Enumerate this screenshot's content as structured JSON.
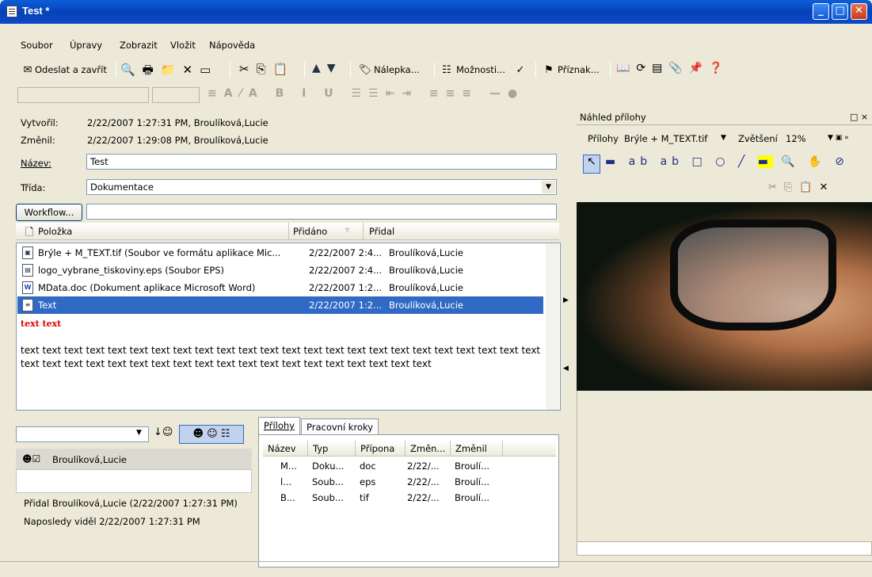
{
  "window": {
    "title": "Test *",
    "min": "_",
    "max": "□",
    "close": "✕"
  },
  "menu": [
    "Soubor",
    "Úpravy",
    "Zobrazit",
    "Vložit",
    "Nápověda"
  ],
  "toolbar": {
    "send_close": "Odeslat a zavřít",
    "label": "Nálepka...",
    "options": "Možnosti...",
    "flag": "Příznak..."
  },
  "form": {
    "created_label": "Vytvořil:",
    "created_value": "2/22/2007 1:27:31 PM, Broulíková,Lucie",
    "modified_label": "Změnil:",
    "modified_value": "2/22/2007 1:29:08 PM, Broulíková,Lucie",
    "name_label": "Název:",
    "name_value": "Test",
    "class_label": "Třída:",
    "class_value": "Dokumentace",
    "workflow_button": "Workflow..."
  },
  "list": {
    "headers": [
      "Položka",
      "Přidáno",
      "Přidal"
    ],
    "rows": [
      {
        "item": "Brýle + M_TEXT.tif (Soubor ve formátu aplikace Mic...",
        "added": "2/22/2007 2:4...",
        "by": "Broulíková,Lucie"
      },
      {
        "item": "logo_vybrane_tiskoviny.eps (Soubor EPS)",
        "added": "2/22/2007 2:4...",
        "by": "Broulíková,Lucie"
      },
      {
        "item": "MData.doc (Dokument aplikace Microsoft Word)",
        "added": "2/22/2007 1:2...",
        "by": "Broulíková,Lucie"
      },
      {
        "item": "Text",
        "added": "2/22/2007 1:2...",
        "by": "Broulíková,Lucie"
      }
    ]
  },
  "text_content": {
    "red": "text text",
    "body": "text text text text text text text text text text text text text text text text text text text text text text text text text text text text text text text text text text text text text text text text text text text"
  },
  "bottom_left": {
    "user": "Broulíková,Lucie",
    "added_info": "Přidal Broulíková,Lucie (2/22/2007 1:27:31 PM)",
    "last_seen": "Naposledy viděl 2/22/2007 1:27:31 PM"
  },
  "tabs": [
    "Přílohy",
    "Pracovní kroky"
  ],
  "attachments": {
    "headers": [
      "Název",
      "Typ",
      "Přípona",
      "Změn...",
      "Změnil"
    ],
    "rows": [
      {
        "name": "M...",
        "type": "Doku...",
        "ext": "doc",
        "date": "2/22/...",
        "by": "Broulí..."
      },
      {
        "name": "l...",
        "type": "Soub...",
        "ext": "eps",
        "date": "2/22/...",
        "by": "Broulí..."
      },
      {
        "name": "B...",
        "type": "Soub...",
        "ext": "tif",
        "date": "2/22/...",
        "by": "Broulí..."
      }
    ]
  },
  "preview": {
    "title": "Náhled přílohy",
    "attachments_label": "Přílohy",
    "attachment_value": "Brýle + M_TEXT.tif",
    "zoom_label": "Zvětšení",
    "zoom_value": "12%"
  }
}
